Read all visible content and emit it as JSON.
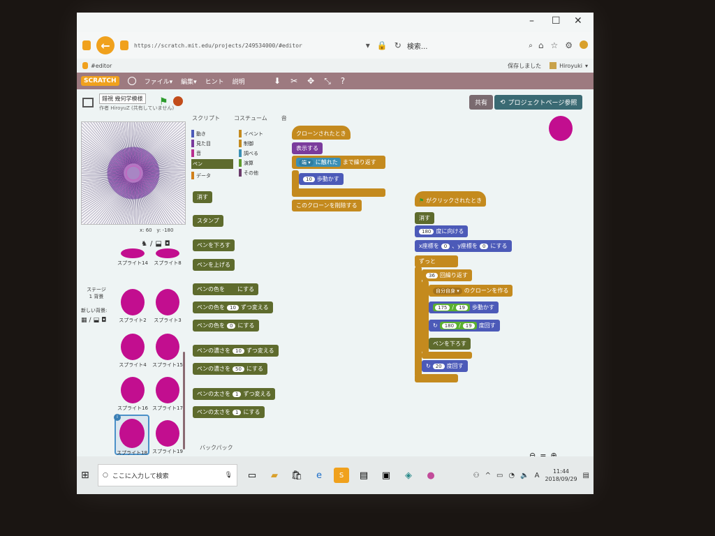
{
  "browser": {
    "url": "https://scratch.mit.edu/projects/249534000/#editor",
    "search_placeholder": "検索...",
    "tab_title": "#editor",
    "save_status": "保存しました",
    "username": "Hiroyuki",
    "window_controls": {
      "minimize": "–",
      "maximize": "☐",
      "close": "✕"
    }
  },
  "menubar": {
    "logo": "SCRATCH",
    "file": "ファイル▾",
    "edit": "編集▾",
    "tips": "ヒント",
    "about": "説明",
    "tool_icons": [
      "stamp-tool-icon",
      "cut-icon",
      "grow-icon",
      "shrink-icon",
      "help-icon"
    ]
  },
  "project": {
    "title": "錯視 幾何学模様",
    "author": "作者 HiroyuZ (共有していません)",
    "share_button": "共有",
    "see_project_button": "プロジェクトページ参照"
  },
  "stage": {
    "x_readout": "x: 60",
    "y_readout": "y: -180"
  },
  "sprites_pane": {
    "stage_label": "ステージ",
    "backdrop_count": "1 背景",
    "new_backdrop": "新しい背景:",
    "sprites": [
      {
        "name": "スプライト14"
      },
      {
        "name": "スプライト8"
      },
      {
        "name": "スプライト2"
      },
      {
        "name": "スプライト3"
      },
      {
        "name": "スプライト4"
      },
      {
        "name": "スプライト15"
      },
      {
        "name": "スプライト16"
      },
      {
        "name": "スプライト17"
      },
      {
        "name": "スプライト18"
      },
      {
        "name": "スプライト19"
      }
    ]
  },
  "palette": {
    "tabs": [
      "スクリプト",
      "コスチューム",
      "音"
    ],
    "categories_left": [
      {
        "label": "動き",
        "color": "#4c5ab8"
      },
      {
        "label": "見た目",
        "color": "#7a3b9c"
      },
      {
        "label": "音",
        "color": "#b8308f"
      },
      {
        "label": "ペン",
        "color": "#5e6b2d"
      },
      {
        "label": "データ",
        "color": "#d0801c"
      }
    ],
    "categories_right": [
      {
        "label": "イベント",
        "color": "#c48a1e"
      },
      {
        "label": "制御",
        "color": "#c48a1e"
      },
      {
        "label": "調べる",
        "color": "#3a8fb5"
      },
      {
        "label": "演算",
        "color": "#5f9a2d"
      },
      {
        "label": "その他",
        "color": "#6b3b6b"
      }
    ],
    "blocks": {
      "clear": "消す",
      "stamp": "スタンプ",
      "pen_down": "ペンを下ろす",
      "pen_up": "ペンを上げる",
      "set_color": "ペンの色を",
      "set_color_tail": "にする",
      "change_color": "ペンの色を",
      "change_color_val": "10",
      "change_color_tail": "ずつ変える",
      "set_color_num": "ペンの色を",
      "set_color_num_val": "0",
      "set_color_num_tail": "にする",
      "change_shade": "ペンの濃さを",
      "change_shade_val": "10",
      "change_shade_tail": "ずつ変える",
      "set_shade": "ペンの濃さを",
      "set_shade_val": "50",
      "set_shade_tail": "にする",
      "change_size": "ペンの太さを",
      "change_size_val": "1",
      "change_size_tail": "ずつ変える",
      "set_size": "ペンの太さを",
      "set_size_val": "1",
      "set_size_tail": "にする"
    },
    "backpack": "バックパック"
  },
  "script1": {
    "hat": "クローンされたとき",
    "show": "表示する",
    "repeat_until": "まで繰り返す",
    "touching_dropdown": "端 ▾",
    "touching": "に触れた",
    "move": "歩動かす",
    "move_val": "10",
    "delete_clone": "このクローンを削除する"
  },
  "script2": {
    "hat": "がクリックされたとき",
    "clear": "消す",
    "point_dir_val": "180",
    "point_dir": "度に向ける",
    "goto_x_label": "x座標を",
    "goto_x_val": "0",
    "goto_y_label": "、y座標を",
    "goto_y_val": "0",
    "goto_tail": "にする",
    "forever": "ずっと",
    "repeat_val": "36",
    "repeat": "回繰り返す",
    "clone_dropdown": "自分自身 ▾",
    "clone": "のクローンを作る",
    "move_a": "175",
    "move_div": "/",
    "move_b": "19",
    "move_tail": "歩動かす",
    "turn_a": "180",
    "turn_div": "/",
    "turn_b": "19",
    "turn_tail": "度回す",
    "pen_down": "ペンを下ろす",
    "turn2_val": "20",
    "turn2_tail": "度回す"
  },
  "taskbar": {
    "search": "ここに入力して検索",
    "time": "11:44",
    "date": "2018/09/29",
    "ime": "A"
  }
}
